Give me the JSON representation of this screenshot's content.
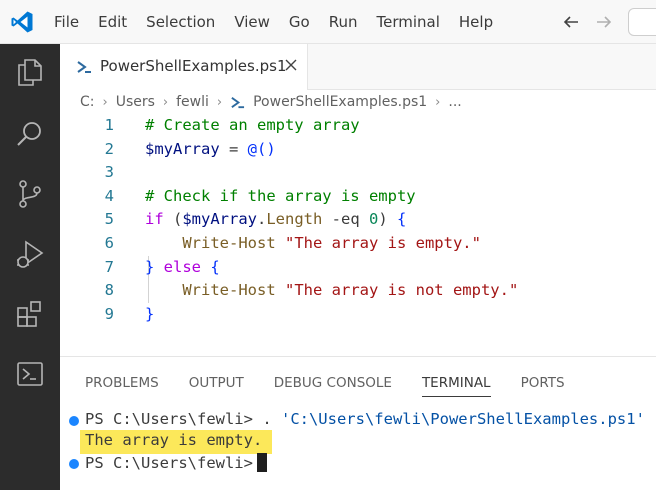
{
  "menu": {
    "items": [
      "File",
      "Edit",
      "Selection",
      "View",
      "Go",
      "Run",
      "Terminal",
      "Help"
    ]
  },
  "editor_tab": {
    "label": "PowerShellExamples.ps1"
  },
  "breadcrumb": {
    "parts": [
      "C:",
      "Users",
      "fewli",
      "PowerShellExamples.ps1",
      "..."
    ]
  },
  "code": {
    "line_numbers": [
      "1",
      "2",
      "3",
      "4",
      "5",
      "6",
      "7",
      "8",
      "9"
    ],
    "l1": "# Create an empty array",
    "l2_var": "$myArray",
    "l2_op": " = ",
    "l2_val": "@()",
    "l4": "# Check if the array is empty",
    "l5_if": "if",
    "l5_open": " (",
    "l5_var": "$myArray",
    "l5_dot": ".",
    "l5_prop": "Length",
    "l5_op": " -eq ",
    "l5_num": "0",
    "l5_close": ") ",
    "l5_brace": "{",
    "l6_cmd": "Write-Host",
    "l6_str": "\"The array is empty.\"",
    "l7_brace1": "}",
    "l7_else": " else ",
    "l7_brace2": "{",
    "l8_cmd": "Write-Host",
    "l8_str": "\"The array is not empty.\"",
    "l9_brace": "}"
  },
  "panel": {
    "tabs": [
      "PROBLEMS",
      "OUTPUT",
      "DEBUG CONSOLE",
      "TERMINAL",
      "PORTS"
    ],
    "active_tab": "TERMINAL"
  },
  "terminal": {
    "prompt1": "PS C:\\Users\\fewli> ",
    "command1": ". ",
    "path1": "'C:\\Users\\fewli\\PowerShellExamples.ps1'",
    "output1": "The array is empty.",
    "prompt2": "PS C:\\Users\\fewli>"
  },
  "colors": {
    "activity_bar": "#2c2c2c",
    "vscode_blue": "#0078d4",
    "terminal_dot": "#1a85ff",
    "highlight": "#fbe43d"
  }
}
